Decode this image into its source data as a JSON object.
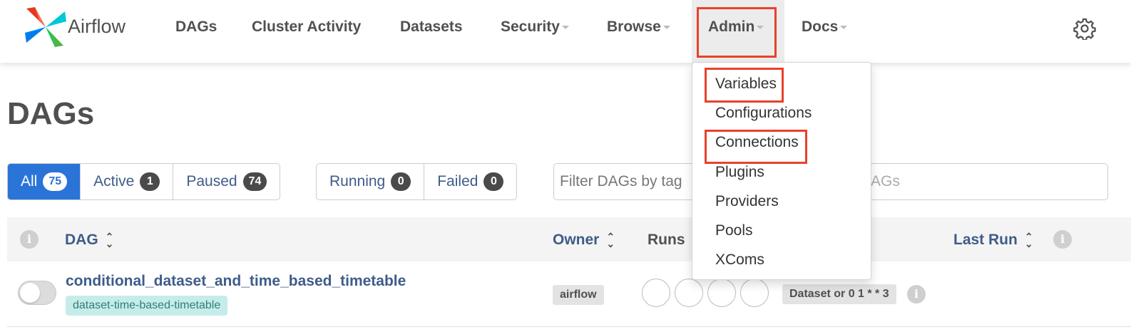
{
  "brand": {
    "name": "Airflow"
  },
  "nav": {
    "dags": "DAGs",
    "cluster_activity": "Cluster Activity",
    "datasets": "Datasets",
    "security": "Security",
    "browse": "Browse",
    "admin": "Admin",
    "docs": "Docs"
  },
  "admin_menu": [
    "Variables",
    "Configurations",
    "Connections",
    "Plugins",
    "Providers",
    "Pools",
    "XComs"
  ],
  "page": {
    "title": "DAGs"
  },
  "filters": {
    "all": {
      "label": "All",
      "count": "75"
    },
    "active": {
      "label": "Active",
      "count": "1"
    },
    "paused": {
      "label": "Paused",
      "count": "74"
    },
    "running": {
      "label": "Running",
      "count": "0"
    },
    "failed": {
      "label": "Failed",
      "count": "0"
    }
  },
  "tag_filter": {
    "placeholder": "Filter DAGs by tag"
  },
  "search": {
    "visible_text": "AGs"
  },
  "table": {
    "headers": {
      "dag": "DAG",
      "owner": "Owner",
      "runs": "Runs",
      "last_run": "Last Run"
    },
    "rows": [
      {
        "dag_id": "conditional_dataset_and_time_based_timetable",
        "tag": "dataset-time-based-timetable",
        "owner": "airflow",
        "schedule": "Dataset or 0 1 * * 3",
        "paused": true
      }
    ]
  },
  "colors": {
    "highlight": "#e8412c",
    "accent": "#2a74d8",
    "link": "#3e5c8a"
  }
}
